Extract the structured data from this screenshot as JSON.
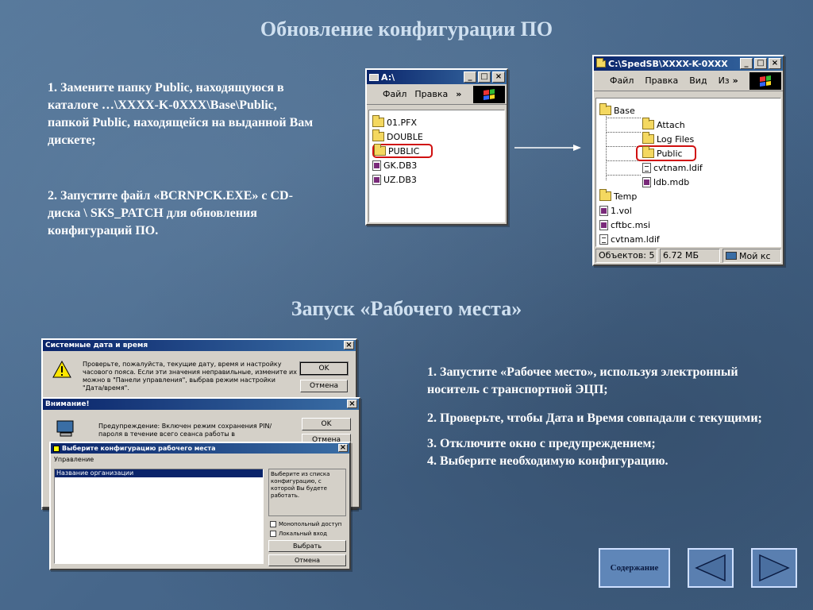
{
  "slide": {
    "title1": "Обновление конфигурации ПО",
    "title2": "Запуск «Рабочего места»"
  },
  "step_block1": {
    "item1": "1.   Замените папку Public, находящуюся в каталоге …\\XXXX-K-0XXX\\Base\\Public, папкой Public, находящейся на выданной Вам дискете;",
    "item2": "2. Запустите файл «BCRNPCK.EXE» с CD-диска \\ SKS_PATCH для обновления конфигураций ПО."
  },
  "step_block2": {
    "item1": "1.   Запустите «Рабочее место», используя электронный носитель с транспортной ЭЦП;",
    "item2": "2.   Проверьте, чтобы Дата и Время совпадали с текущими;",
    "item3": "3.   Отключите окно с предупреждением;",
    "item4": "4.   Выберите необходимую конфигурацию."
  },
  "explorer_a": {
    "title": "A:\\",
    "menu": [
      "Файл",
      "Правка"
    ],
    "files": [
      "01.PFX",
      "DOUBLE",
      "PUBLIC",
      "GK.DB3",
      "UZ.DB3"
    ]
  },
  "explorer_c": {
    "title": "C:\\SpedSB\\XXXX-K-0XXX",
    "menu": [
      "Файл",
      "Правка",
      "Вид",
      "Из"
    ],
    "tree": [
      "Base",
      "Attach",
      "Log Files",
      "Public",
      "cvtnam.ldif",
      "ldb.mdb",
      "Temp",
      "1.vol",
      "cftbc.msi",
      "cvtnam.ldif"
    ],
    "status_objects": "Объектов: 5",
    "status_size": "6.72 МБ",
    "status_location": "Мой кс"
  },
  "dialog_datetime": {
    "title": "Системные дата и время",
    "text": "Проверьте, пожалуйста, текущие дату, время и настройку часового пояса. Если эти значения неправильные, измените их можно в \"Панели управления\", выбрав режим настройки \"Дата/время\".",
    "ok": "OK",
    "cancel": "Отмена"
  },
  "dialog_warning": {
    "title": "Внимание!",
    "text": "Предупреждение: Включен режим сохранения PIN/пароля в течение всего сеанса работы в",
    "ok": "OK",
    "cancel": "Отмена"
  },
  "dialog_config": {
    "title": "Выберите конфигурацию рабочего места",
    "menu": "Управление",
    "list_header": "Название организации",
    "hint": "Выберите из списка конфигурацию, с которой Вы будете работать.",
    "check1": "Монопольный доступ",
    "check2": "Локальный вход",
    "select": "Выбрать",
    "cancel": "Отмена"
  },
  "nav": {
    "contents": "Содержание"
  },
  "colors": {
    "title_text": "#cfe0f0",
    "titlebar": "#0a246a",
    "highlight": "#d01010"
  }
}
